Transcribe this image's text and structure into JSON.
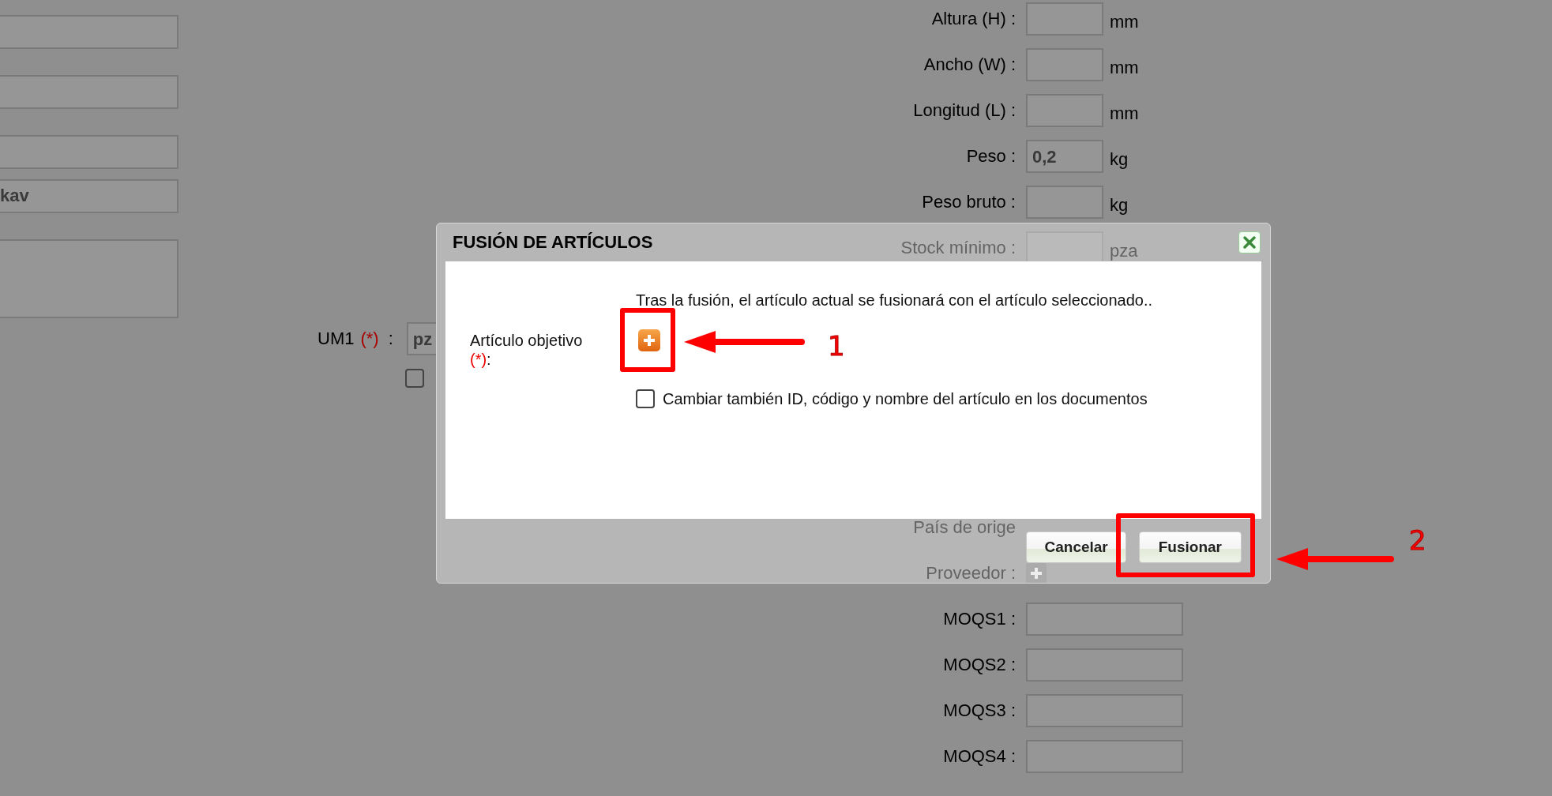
{
  "left_form": {
    "fields": [
      {
        "kind": "input"
      },
      {
        "kind": "input"
      },
      {
        "kind": "input"
      },
      {
        "kind": "input",
        "value": "kav"
      },
      {
        "kind": "textarea"
      }
    ]
  },
  "um1": {
    "label": "UM1",
    "required": "(*)",
    "colon": ":",
    "value": "pz",
    "checkbox": {
      "checked": false
    }
  },
  "right_form": {
    "rows_top": [
      {
        "label": "Altura (H) :",
        "kind": "input",
        "unit": "mm"
      },
      {
        "label": "Ancho (W) :",
        "kind": "input",
        "unit": "mm"
      },
      {
        "label": "Longitud (L) :",
        "kind": "input",
        "unit": "mm"
      },
      {
        "label": "Peso :",
        "kind": "input",
        "value": "0,2",
        "unit": "kg"
      },
      {
        "label": "Peso bruto :",
        "kind": "input",
        "unit": "kg"
      },
      {
        "label": "Stock mínimo :",
        "kind": "input",
        "unit": "pza"
      }
    ],
    "rows_bottom": [
      {
        "label": "País de orige",
        "kind": "label"
      },
      {
        "label": "Proveedor :",
        "kind": "picker"
      },
      {
        "label": "MOQS1 :",
        "kind": "wide"
      },
      {
        "label": "MOQS2 :",
        "kind": "wide"
      },
      {
        "label": "MOQS3 :",
        "kind": "wide"
      },
      {
        "label": "MOQS4 :",
        "kind": "wide"
      }
    ]
  },
  "dialog": {
    "title": "FUSIÓN DE ARTÍCULOS",
    "message": "Tras la fusión, el artículo actual se fusionará con el artículo seleccionado..",
    "target_label": "Artículo objetivo",
    "target_required": "(*)",
    "target_colon": ":",
    "also_change": {
      "label": "Cambiar también ID, código y nombre del artículo en los documentos",
      "checked": false
    },
    "buttons": [
      {
        "label": "Cancelar"
      },
      {
        "label": "Fusionar"
      }
    ]
  },
  "annotations": [
    {
      "number": "1"
    },
    {
      "number": "2"
    }
  ]
}
